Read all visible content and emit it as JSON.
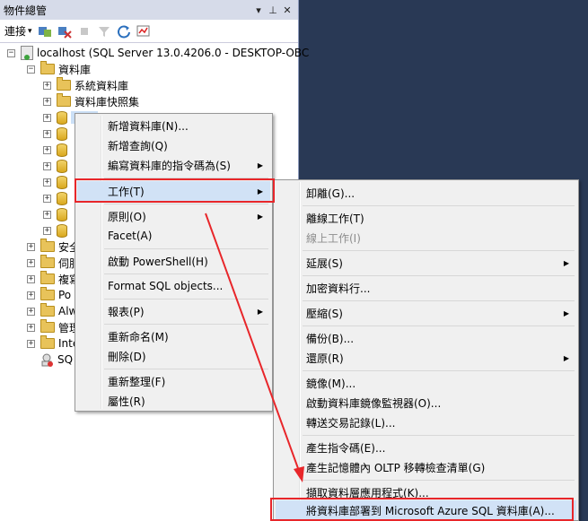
{
  "panel": {
    "title": "物件總管",
    "pin_glyph": "▾",
    "pin2_glyph": "⊥",
    "close_glyph": "✕"
  },
  "toolbar": {
    "connect_label": "連接",
    "connect_caret": "▾"
  },
  "tree": {
    "server_label": "localhost (SQL Server 13.0.4206.0 - DESKTOP-OBC",
    "databases_label": "資料庫",
    "system_db_label": "系統資料庫",
    "snapshot_label": "資料庫快照集",
    "selected_db_label": "",
    "partial_labels": [
      "安全",
      "伺服",
      "複寫",
      "Po",
      "Alw",
      "管理",
      "Inte",
      "SQ"
    ]
  },
  "menu1": {
    "items": [
      "新增資料庫(N)...",
      "新增查詢(Q)",
      "編寫資料庫的指令碼為(S)",
      "工作(T)",
      "原則(O)",
      "Facet(A)",
      "啟動 PowerShell(H)",
      "Format SQL objects...",
      "報表(P)",
      "重新命名(M)",
      "刪除(D)",
      "重新整理(F)",
      "屬性(R)"
    ]
  },
  "menu2": {
    "items": [
      "卸離(G)...",
      "離線工作(T)",
      "線上工作(I)",
      "延展(S)",
      "加密資料行...",
      "壓縮(S)",
      "備份(B)...",
      "還原(R)",
      "鏡像(M)...",
      "啟動資料庫鏡像監視器(O)...",
      "轉送交易記錄(L)...",
      "產生指令碼(E)...",
      "產生記憶體內 OLTP 移轉檢查清單(G)",
      "擷取資料層應用程式(K)...",
      "將資料庫部署到 Microsoft Azure SQL 資料庫(A)..."
    ]
  },
  "arrow_glyph": "▶",
  "colors": {
    "accent_red": "#e8262a",
    "background": "#293955",
    "menu_bg": "#f0f0f0"
  }
}
